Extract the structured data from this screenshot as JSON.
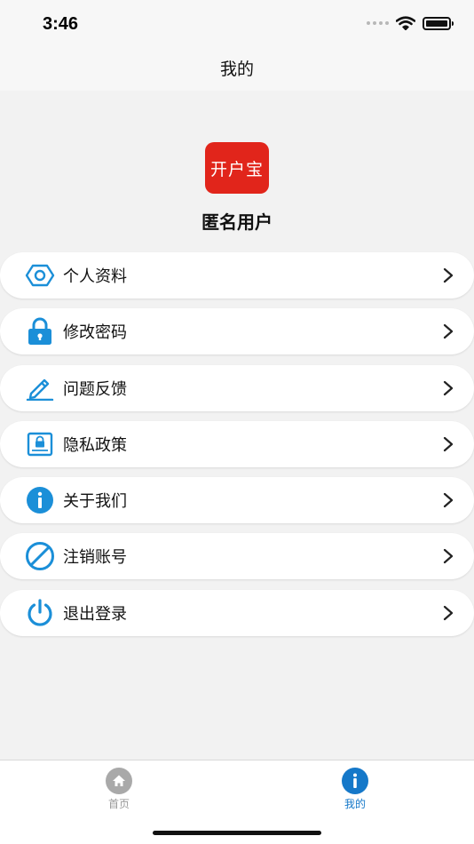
{
  "status_bar": {
    "time": "3:46"
  },
  "nav": {
    "title": "我的"
  },
  "profile": {
    "logo_text": "开户宝",
    "username": "匿名用户"
  },
  "menu": [
    {
      "label": "个人资料",
      "icon": "hexagon-nut-icon"
    },
    {
      "label": "修改密码",
      "icon": "lock-icon"
    },
    {
      "label": "问题反馈",
      "icon": "pencil-icon"
    },
    {
      "label": "隐私政策",
      "icon": "privacy-document-icon"
    },
    {
      "label": "关于我们",
      "icon": "info-icon"
    },
    {
      "label": "注销账号",
      "icon": "prohibited-icon"
    },
    {
      "label": "退出登录",
      "icon": "power-icon"
    }
  ],
  "tabs": {
    "home": "首页",
    "mine": "我的"
  },
  "colors": {
    "accent": "#1b8fd8",
    "logo_bg": "#e1251b",
    "tab_active": "#1578c9",
    "tab_inactive": "#999999"
  }
}
